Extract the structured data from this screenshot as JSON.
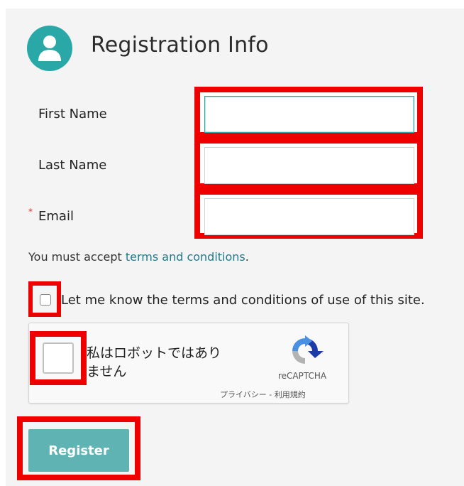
{
  "header": {
    "title": "Registration Info",
    "avatar_icon": "user-icon",
    "accent_color": "#2aa7a7"
  },
  "form": {
    "first_name_label": "First Name",
    "first_name_value": "",
    "last_name_label": "Last Name",
    "last_name_value": "",
    "email_required_mark": "*",
    "email_label": "Email",
    "email_value": ""
  },
  "terms": {
    "prefix": "You must accept ",
    "link_text": "terms and conditions",
    "suffix": ".",
    "checkbox_label": "Let me know the terms and conditions of use of this site.",
    "checked": false
  },
  "captcha": {
    "label_line1": "私はロボットではあり",
    "label_line2": "ません",
    "brand": "reCAPTCHA",
    "links": "プライバシー - 利用規約",
    "icon": "recaptcha-icon"
  },
  "actions": {
    "register_label": "Register",
    "button_color": "#5fb3b3"
  },
  "highlight_color": "#ee0000"
}
